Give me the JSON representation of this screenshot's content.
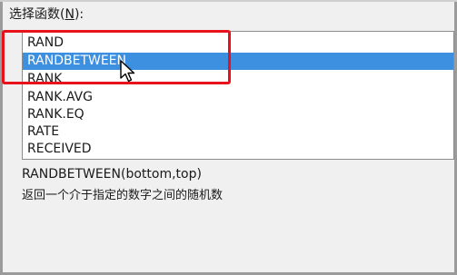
{
  "dialog": {
    "select_label": {
      "prefix": "选择函数(",
      "hotkey": "N",
      "suffix": "):"
    }
  },
  "function_list": {
    "items": [
      "RAND",
      "RANDBETWEEN",
      "RANK",
      "RANK.AVG",
      "RANK.EQ",
      "RATE",
      "RECEIVED"
    ],
    "selected_index": 1,
    "selected_color": "#3d8fe0"
  },
  "help": {
    "signature": "RANDBETWEEN(bottom,top)",
    "description": "返回一个介于指定的数字之间的随机数"
  },
  "annotation": {
    "highlight_color": "#e8121c",
    "cursor": "arrow-pointer-icon"
  }
}
